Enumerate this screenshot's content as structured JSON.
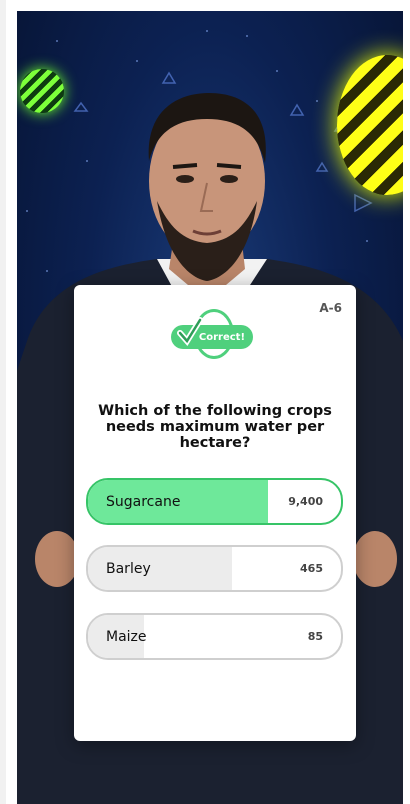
{
  "question": {
    "id": "A-6",
    "badge": "Correct!",
    "text": "Which of the following crops needs maximum water per hectare?"
  },
  "options": [
    {
      "label": "Sugarcane",
      "count": "9,400",
      "share": 0.71,
      "correct": true
    },
    {
      "label": "Barley",
      "count": "465",
      "share": 0.57,
      "correct": false
    },
    {
      "label": "Maize",
      "count": "85",
      "share": 0.22,
      "correct": false
    }
  ],
  "colors": {
    "correct_green": "#4fd07d",
    "correct_fill": "#6ee89a",
    "background_navy": "#0c2152",
    "neon_yellow": "#ffff17",
    "neon_green": "#7dff3a",
    "neon_cyan": "#3ff3ff"
  },
  "icons": {
    "badge": "check-icon"
  }
}
